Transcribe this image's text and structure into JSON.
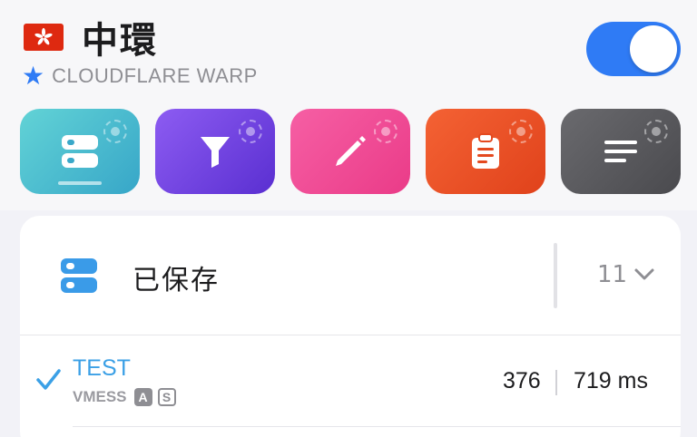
{
  "header": {
    "flag_icon": "hong-kong-flag-icon",
    "title": "中環",
    "subtitle_icon": "star-icon",
    "subtitle": "CLOUDFLARE WARP",
    "toggle_on": true,
    "accent": "#2f7bf5"
  },
  "tiles": [
    {
      "icon": "servers-icon",
      "selected": true,
      "color": "#37a6c8"
    },
    {
      "icon": "filter-icon",
      "selected": false,
      "color": "#5a2fd1"
    },
    {
      "icon": "pencil-icon",
      "selected": false,
      "color": "#ea3b88"
    },
    {
      "icon": "clipboard-icon",
      "selected": false,
      "color": "#e0421b"
    },
    {
      "icon": "text-lines-icon",
      "selected": false,
      "color": "#4a4a4e"
    }
  ],
  "group": {
    "icon": "servers-icon",
    "title": "已保存",
    "count": "11",
    "chevron": "chevron-down-icon"
  },
  "servers": [
    {
      "selected": true,
      "name": "TEST",
      "protocol": "VMESS",
      "badges": [
        "A",
        "S"
      ],
      "latency": "376",
      "latency_ms": "719 ms"
    }
  ]
}
